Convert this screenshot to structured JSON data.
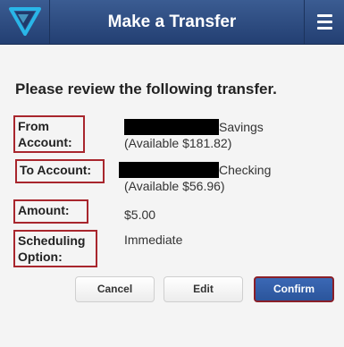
{
  "header": {
    "title": "Make a Transfer",
    "logo_icon": "logo-icon",
    "menu_icon": "hamburger-menu-icon"
  },
  "main": {
    "heading": "Please review the following transfer.",
    "from": {
      "label_line1": "From",
      "label_line2": "Account:",
      "account_type": "Savings",
      "available": "(Available $181.82)"
    },
    "to": {
      "label": "To Account:",
      "account_type": "Checking",
      "available": "(Available $56.96)"
    },
    "amount": {
      "label": "Amount:",
      "value": "$5.00"
    },
    "scheduling": {
      "label_line1": "Scheduling",
      "label_line2": "Option:",
      "value": "Immediate"
    }
  },
  "actions": {
    "cancel_label": "Cancel",
    "edit_label": "Edit",
    "confirm_label": "Confirm"
  },
  "colors": {
    "header_top": "#3b5c92",
    "header_bottom": "#233f72",
    "highlight_border": "#a8262d",
    "confirm_bg": "#2b559c"
  }
}
